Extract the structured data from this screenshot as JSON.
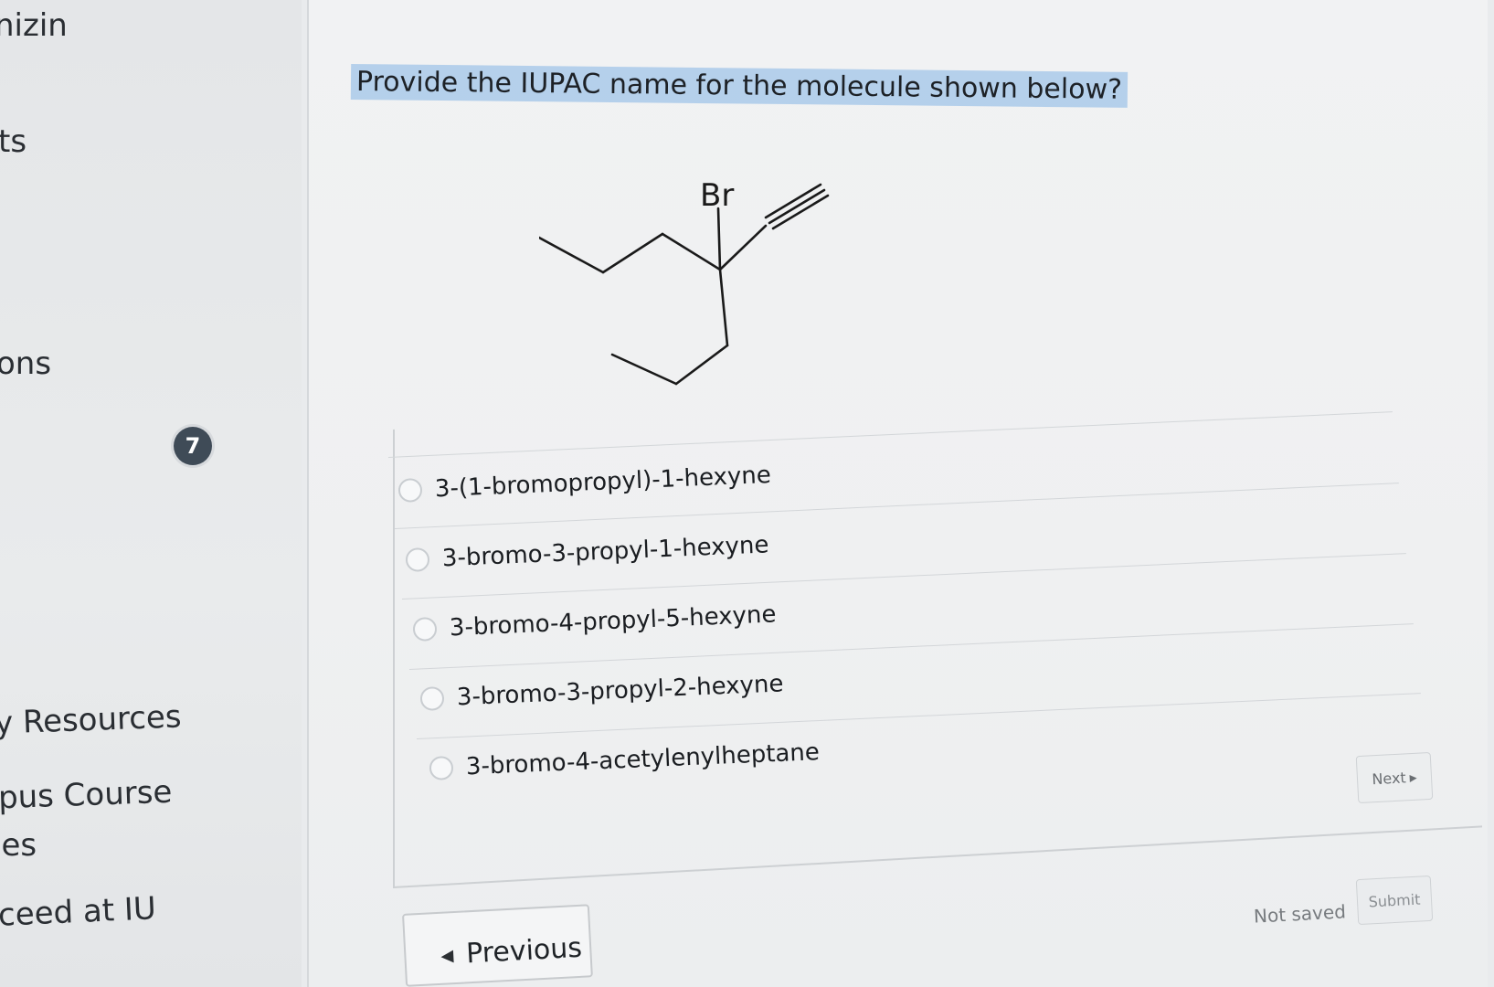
{
  "sidebar": {
    "items": [
      {
        "label": "nizin"
      },
      {
        "label": "ts"
      },
      {
        "label": "ons"
      },
      {
        "label": "y Resources"
      },
      {
        "label": "pus Course"
      },
      {
        "label": "ies"
      },
      {
        "label": "ceed at IU"
      }
    ],
    "badge_count": "7"
  },
  "question": {
    "prompt": "Provide the IUPAC name for the molecule shown below?",
    "molecule_label": "Br",
    "choices": [
      {
        "label": "3-(1-bromopropyl)-1-hexyne"
      },
      {
        "label": "3-bromo-3-propyl-1-hexyne"
      },
      {
        "label": "3-bromo-4-propyl-5-hexyne"
      },
      {
        "label": "3-bromo-3-propyl-2-hexyne"
      },
      {
        "label": "3-bromo-4-acetylenylheptane"
      }
    ]
  },
  "footer": {
    "previous_label": "Previous",
    "next_label": "Next",
    "status": "Not saved",
    "submit_label": "Submit"
  },
  "colors": {
    "highlight": "#a0c4e8",
    "badge": "#3f4b57"
  }
}
